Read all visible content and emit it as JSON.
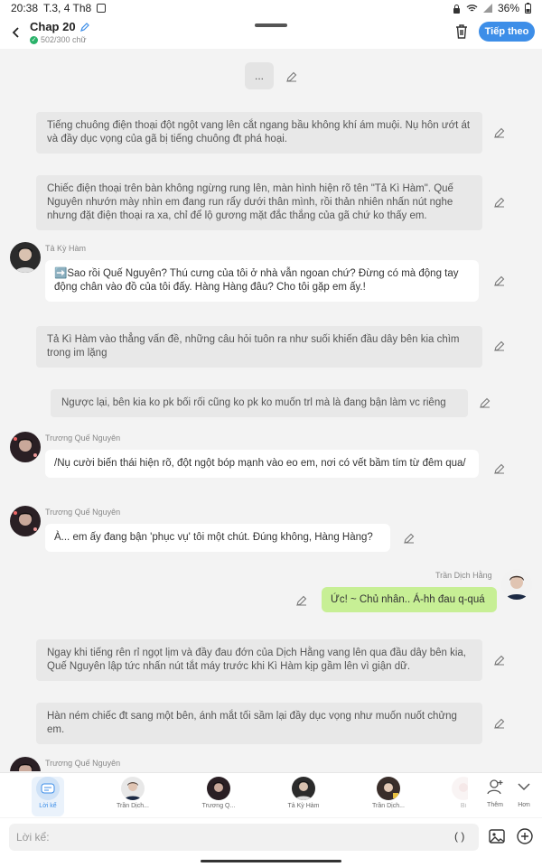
{
  "status": {
    "time": "20:38",
    "date": "T.3, 4 Th8",
    "battery": "36%"
  },
  "header": {
    "title": "Chap 20",
    "counter": "502/300 chữ",
    "next_label": "Tiếp theo"
  },
  "colors": {
    "accent": "#3d8ee8",
    "own_bubble": "#c7ef95",
    "narration_bg": "#e8e8e8"
  },
  "messages": {
    "ellipsis": "...",
    "n1": "Tiếng chuông điện thoại đột ngột vang lên cắt ngang bầu không khí ám muội. Nụ hôn ướt át và đầy dục vọng của gã bị tiếng chuông đt phá hoại.",
    "n2": "Chiếc điện thoại trên bàn không ngừng rung lên, màn hình hiện rõ tên \"Tả Kì Hàm\". Quế Nguyên nhướn mày nhìn em đang run rẩy dưới thân mình, rồi thản nhiên nhấn nút nghe nhưng đặt điện thoại ra xa, chỉ để lộ gương mặt đắc thắng của gã chứ ko thấy em.",
    "s1_name": "Tả Kỳ Hàm",
    "s1_text": "➡️Sao rồi Quế Nguyên? Thú cưng của tôi ở nhà vẫn ngoan chứ? Đừng có mà động tay động chân vào đồ của tôi đấy. Hàng Hàng đâu? Cho tôi gặp em ấy.!",
    "n3": "Tả Kì Hàm vào thẳng vấn đề, những câu hỏi tuôn ra như suối khiến đầu dây bên kia chìm trong im lặng",
    "n4": "Ngược lại, bên kia ko pk bối rối cũng ko pk ko muốn trl mà là đang bận làm vc riêng",
    "s2_name": "Trương Quế Nguyên",
    "s2_text": "/Nụ cười biến thái hiện rõ, đột ngột bóp mạnh vào eo em, nơi có vết bầm tím từ đêm qua/",
    "s3_name": "Trương Quế Nguyên",
    "s3_text": "À... em ấy đang bận 'phục vụ' tôi một chút. Đúng không, Hàng Hàng?",
    "me_name": "Trần Dịch Hằng",
    "me_text": "Ức! ~ Chủ nhân.. Á-hh đau q-quá",
    "n5": "Ngay khi tiếng rên rỉ ngọt lịm và đầy đau đớn của Dịch Hằng vang lên qua đầu dây bên kia, Quế Nguyên lập tức nhấn nút tắt máy trước khi Kì Hàm kịp gầm lên vì giận dữ.",
    "n6": "Hàn ném chiếc đt sang một bên, ánh mắt tối sầm lại đầy dục vọng như muốn nuốt chửng em.",
    "s4_name": "Trương Quế Nguyên"
  },
  "characters": {
    "c0": "Lời kể",
    "c1": "Trần Dịch...",
    "c2": "Trương Q...",
    "c3": "Tả Kỳ Hàm",
    "c4": "Trần Dịch...",
    "c5": "Bi",
    "add": "Thêm",
    "more": "Hơn"
  },
  "composer": {
    "placeholder": "Lời kể:",
    "paren": "( )"
  }
}
